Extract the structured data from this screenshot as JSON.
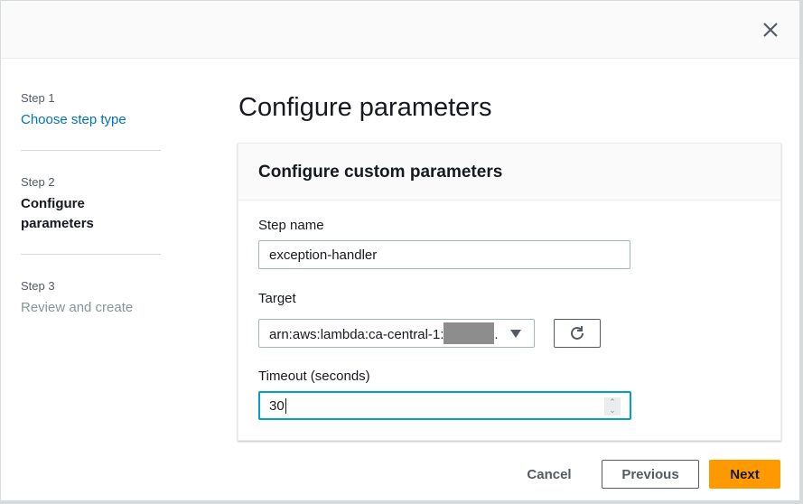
{
  "steps": [
    {
      "num": "Step 1",
      "label": "Choose step type"
    },
    {
      "num": "Step 2",
      "label": "Configure parameters"
    },
    {
      "num": "Step 3",
      "label": "Review and create"
    }
  ],
  "title": "Configure parameters",
  "panel": {
    "title": "Configure custom parameters",
    "step_name_label": "Step name",
    "step_name_value": "exception-handler",
    "target_label": "Target",
    "target_value": "arn:aws:lambda:ca-central-1:",
    "target_suffix": ".",
    "timeout_label": "Timeout (seconds)",
    "timeout_value": "30"
  },
  "buttons": {
    "cancel": "Cancel",
    "previous": "Previous",
    "next": "Next"
  }
}
